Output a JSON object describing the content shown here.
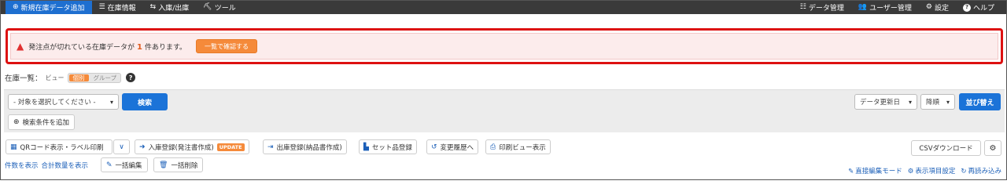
{
  "nav": {
    "left": [
      {
        "icon": "plus-circle-icon",
        "glyph": "⊕",
        "label": "新規在庫データ追加"
      },
      {
        "icon": "list-icon",
        "glyph": "☰",
        "label": "在庫情報"
      },
      {
        "icon": "inout-icon",
        "glyph": "⇆",
        "label": "入庫/出庫"
      },
      {
        "icon": "tools-icon",
        "glyph": "⛏",
        "label": "ツール"
      }
    ],
    "right": [
      {
        "icon": "data-manage-icon",
        "glyph": "☷",
        "label": "データ管理"
      },
      {
        "icon": "users-icon",
        "glyph": "👥",
        "label": "ユーザー管理"
      },
      {
        "icon": "gear-icon",
        "glyph": "⚙",
        "label": "設定"
      },
      {
        "icon": "help-icon",
        "glyph": "?",
        "label": "ヘルプ"
      }
    ]
  },
  "alert": {
    "message_before": "発注点が切れている在庫データが",
    "count": "1",
    "message_after": "件あります。",
    "button": "一覧で確認する"
  },
  "list": {
    "title": "在庫一覧：",
    "view_label": "ビュー",
    "view_individual": "個別",
    "view_group": "グループ",
    "help_glyph": "?"
  },
  "filter": {
    "target_select": "- 対象を選択してください -",
    "search_button": "検索",
    "add_condition": "検索条件を追加",
    "sort_field": "データ更新日",
    "sort_order": "降順",
    "sort_button": "並び替え"
  },
  "toolbar": {
    "qr": "QRコード表示・ラベル印刷",
    "inbound": "入庫登録(発注書作成)",
    "update_badge": "UPDATE",
    "outbound": "出庫登録(納品書作成)",
    "set_register": "セット品登録",
    "history": "変更履歴へ",
    "print_view": "印刷ビュー表示",
    "csv": "CSVダウンロード"
  },
  "bottom": {
    "show_count": "件数を表示",
    "show_total": "合計数量を表示",
    "bulk_edit": "一括編集",
    "bulk_delete": "一括削除",
    "direct_edit": "直接編集モード",
    "display_items": "表示項目設定",
    "reload": "再読み込み"
  }
}
